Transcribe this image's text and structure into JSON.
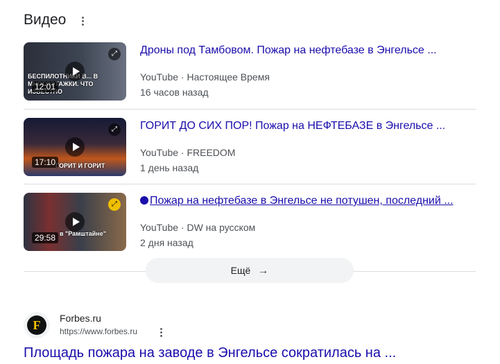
{
  "section": {
    "title": "Видео"
  },
  "videos": [
    {
      "title": "Дроны под Тамбовом. Пожар на нефтебазе в Энгельсе ...",
      "source": "YouTube",
      "channel": "Настоящее Время",
      "time_ago": "16 часов назад",
      "duration": "12:01",
      "thumb_caption": "БЕСПИЛОТНИКИ В... В МНОГОЭТАЖКИ. ЧТО ИЗВЕСТНО",
      "thumb_colors": [
        "#2a2f3a",
        "#5b6270"
      ]
    },
    {
      "title": "ГОРИТ ДО СИХ ПОР! Пожар на НЕФТЕБАЗЕ в Энгельсе ...",
      "source": "YouTube",
      "channel": "FREEDOM",
      "time_ago": "1 день назад",
      "duration": "17:10",
      "thumb_caption": "ГОРИТ И ГОРИТ",
      "thumb_colors": [
        "#1c2340",
        "#c0561c"
      ]
    },
    {
      "title": "Пожар на нефтебазе в Энгельсе не потушен, последний ...",
      "source": "YouTube",
      "channel": "DW на русском",
      "time_ago": "2 дня назад",
      "duration": "29:58",
      "thumb_caption": "в \"Рамштайне\"",
      "thumb_colors": [
        "#3a3f4a",
        "#8a6a4a"
      ]
    }
  ],
  "separator": "·",
  "more": {
    "label": "Ещё",
    "arrow": "→"
  },
  "result": {
    "site_name": "Forbes.ru",
    "url": "https://www.forbes.ru",
    "logo_letter": "F",
    "title": "Площадь пожара на заводе в Энгельсе сократилась на ..."
  },
  "colors": {
    "link": "#1a0dab",
    "meta": "#4d5156",
    "divider": "#dadce0"
  }
}
